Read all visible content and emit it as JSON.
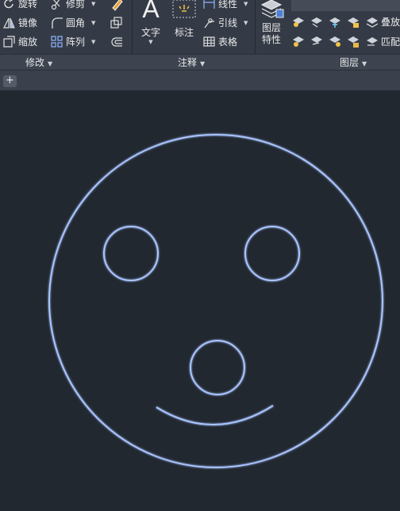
{
  "ribbon": {
    "modify": {
      "title": "修改",
      "rotate": "旋转",
      "mirror": "镜像",
      "scale": "缩放",
      "trim": "修剪",
      "fillet": "圆角",
      "array": "阵列"
    },
    "annotation": {
      "title": "注释",
      "text": "文字",
      "dimension": "标注",
      "linear": "线性",
      "leader": "引线",
      "table": "表格"
    },
    "layers": {
      "title": "图层",
      "properties_line1": "图层",
      "properties_line2": "特性",
      "stack": "叠放",
      "match": "匹配"
    }
  },
  "tabs": {
    "add_label": "+"
  },
  "colors": {
    "ribbon_bg": "#353b46",
    "canvas_bg": "#212830",
    "drawing_stroke": "#a9c4ff"
  }
}
